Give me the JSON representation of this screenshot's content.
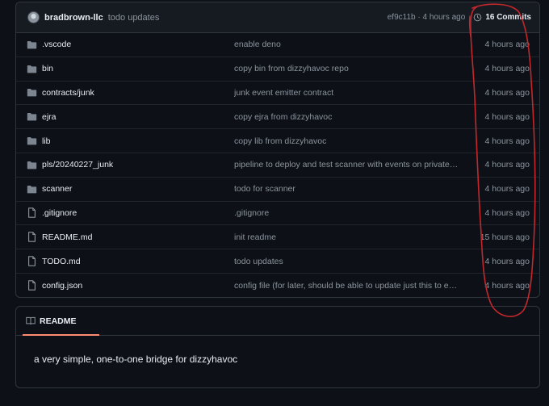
{
  "commit_header": {
    "author": "bradbrown-llc",
    "message": "todo updates",
    "meta": "ef9c11b · 4 hours ago",
    "commits_label": "16 Commits"
  },
  "files": [
    {
      "type": "folder",
      "name": ".vscode",
      "message": "enable deno",
      "age": "4 hours ago"
    },
    {
      "type": "folder",
      "name": "bin",
      "message": "copy bin from dizzyhavoc repo",
      "age": "4 hours ago"
    },
    {
      "type": "folder",
      "name": "contracts/junk",
      "message": "junk event emitter contract",
      "age": "4 hours ago"
    },
    {
      "type": "folder",
      "name": "ejra",
      "message": "copy ejra from dizzyhavoc",
      "age": "4 hours ago"
    },
    {
      "type": "folder",
      "name": "lib",
      "message": "copy lib from dizzyhavoc",
      "age": "4 hours ago"
    },
    {
      "type": "folder",
      "name": "pls/20240227_junk",
      "message": "pipeline to deploy and test scanner with events on private n...",
      "age": "4 hours ago"
    },
    {
      "type": "folder",
      "name": "scanner",
      "message": "todo for scanner",
      "age": "4 hours ago"
    },
    {
      "type": "file",
      "name": ".gitignore",
      "message": ".gitignore",
      "age": "4 hours ago"
    },
    {
      "type": "file",
      "name": "README.md",
      "message": "init readme",
      "age": "15 hours ago"
    },
    {
      "type": "file",
      "name": "TODO.md",
      "message": "todo updates",
      "age": "4 hours ago"
    },
    {
      "type": "file",
      "name": "config.json",
      "message": "config file (for later, should be able to update just this to en...",
      "age": "4 hours ago"
    }
  ],
  "icons": {
    "folder": "folder-icon",
    "file": "file-icon",
    "history": "history-icon",
    "book": "book-icon"
  },
  "readme": {
    "tab_label": "README",
    "body": "a very simple, one-to-one bridge for dizzyhavoc"
  },
  "colors": {
    "background": "#0d1117",
    "border": "#30363d",
    "muted_text": "#8b949e",
    "folder_icon": "#7d8590",
    "annotation": "#c3272b",
    "tab_underline": "#fd8c73"
  }
}
